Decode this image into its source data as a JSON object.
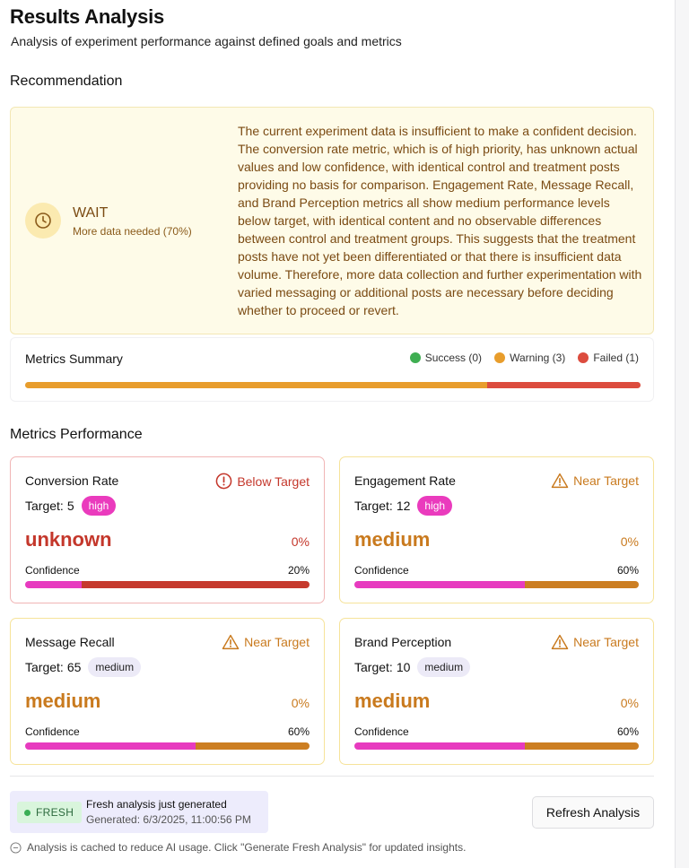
{
  "header": {
    "title": "Results Analysis",
    "subtitle": "Analysis of experiment performance against defined goals and metrics"
  },
  "recommendation": {
    "section_title": "Recommendation",
    "decision": "WAIT",
    "confidence_text": "More data needed (70%)",
    "confidence": 0.7,
    "icon": "clock-icon",
    "text": "The current experiment data is insufficient to make a confident decision. The conversion rate metric, which is of high priority, has unknown actual values and low confidence, with identical control and treatment posts providing no basis for comparison. Engagement Rate, Message Recall, and Brand Perception metrics all show medium performance levels below target, with identical content and no observable differences between control and treatment groups. This suggests that the treatment posts have not yet been differentiated or that there is insufficient data volume. Therefore, more data collection and further experimentation with varied messaging or additional posts are necessary before deciding whether to proceed or revert."
  },
  "summary": {
    "title": "Metrics Summary",
    "legend": [
      {
        "label": "Success (0)",
        "count": 0,
        "color": "#3fae52"
      },
      {
        "label": "Warning (3)",
        "count": 3,
        "color": "#e89d2c"
      },
      {
        "label": "Failed (1)",
        "count": 1,
        "color": "#dc4c3e"
      }
    ]
  },
  "performance": {
    "section_title": "Metrics Performance",
    "confidence_label": "Confidence",
    "target_prefix": "Target:",
    "metrics": [
      {
        "name": "Conversion Rate",
        "status": "Below Target",
        "status_kind": "below",
        "status_icon": "alert-circle-icon",
        "target": "5",
        "priority": "high",
        "value": "unknown",
        "change": "0%",
        "confidence_label": "20%",
        "confidence": 0.2
      },
      {
        "name": "Engagement Rate",
        "status": "Near Target",
        "status_kind": "near",
        "status_icon": "warning-triangle-icon",
        "target": "12",
        "priority": "high",
        "value": "medium",
        "change": "0%",
        "confidence_label": "60%",
        "confidence": 0.6
      },
      {
        "name": "Message Recall",
        "status": "Near Target",
        "status_kind": "near",
        "status_icon": "warning-triangle-icon",
        "target": "65",
        "priority": "medium",
        "value": "medium",
        "change": "0%",
        "confidence_label": "60%",
        "confidence": 0.6
      },
      {
        "name": "Brand Perception",
        "status": "Near Target",
        "status_kind": "near",
        "status_icon": "warning-triangle-icon",
        "target": "10",
        "priority": "medium",
        "value": "medium",
        "change": "0%",
        "confidence_label": "60%",
        "confidence": 0.6
      }
    ]
  },
  "footer": {
    "badge": "FRESH",
    "fresh_title": "Fresh analysis just generated",
    "generated": "Generated: 6/3/2025, 11:00:56 PM",
    "refresh_label": "Refresh Analysis",
    "cache_note": "Analysis is cached to reduce AI usage. Click \"Generate Fresh Analysis\" for updated insights."
  },
  "colors": {
    "below": "#c4372b",
    "near": "#c97a1e",
    "pink": "#e73bbf",
    "below_bar": "#c63a2d",
    "near_bar": "#cc7e22"
  }
}
